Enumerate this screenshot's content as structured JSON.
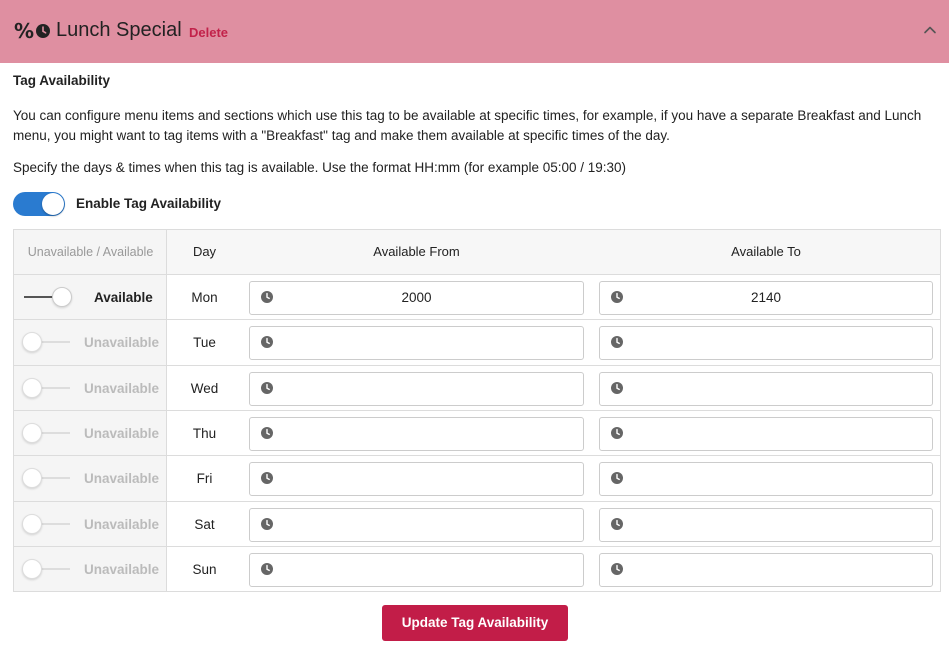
{
  "header": {
    "percent_symbol": "%",
    "icon": "clock-icon",
    "title": "Lunch Special",
    "delete_label": "Delete",
    "collapse_icon": "chevron-up-icon",
    "background": "#df8fa1"
  },
  "availability": {
    "section_title": "Tag Availability",
    "description": "You can configure menu items and sections which use this tag to be available at specific times, for example, if you have a separate Breakfast and Lunch menu, you might want to tag items with a \"Breakfast\" tag and make them available at specific times of the day.",
    "specify_text": "Specify the days & times when this tag is available. Use the format HH:mm (for example 05:00 / 19:30)",
    "enable_label": "Enable Tag Availability",
    "enabled": true
  },
  "table": {
    "headers": {
      "availability": "Unavailable / Available",
      "day": "Day",
      "from": "Available From",
      "to": "Available To"
    },
    "rows": [
      {
        "day": "Mon",
        "state": "Available",
        "available": true,
        "from": "2000",
        "to": "2140"
      },
      {
        "day": "Tue",
        "state": "Unavailable",
        "available": false,
        "from": "",
        "to": ""
      },
      {
        "day": "Wed",
        "state": "Unavailable",
        "available": false,
        "from": "",
        "to": ""
      },
      {
        "day": "Thu",
        "state": "Unavailable",
        "available": false,
        "from": "",
        "to": ""
      },
      {
        "day": "Fri",
        "state": "Unavailable",
        "available": false,
        "from": "",
        "to": ""
      },
      {
        "day": "Sat",
        "state": "Unavailable",
        "available": false,
        "from": "",
        "to": ""
      },
      {
        "day": "Sun",
        "state": "Unavailable",
        "available": false,
        "from": "",
        "to": ""
      }
    ]
  },
  "actions": {
    "update_label": "Update Tag Availability",
    "color": "#c21d48"
  },
  "colors": {
    "toggle_on": "#2a7bd0",
    "delete_text": "#c2224a"
  }
}
